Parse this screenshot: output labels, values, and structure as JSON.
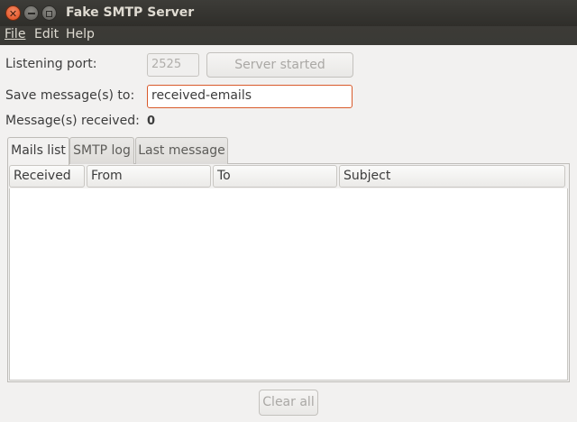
{
  "window": {
    "title": "Fake SMTP Server"
  },
  "menu": {
    "file": "File",
    "edit": "Edit",
    "help": "Help"
  },
  "form": {
    "port_label": "Listening port:",
    "port_value": "2525",
    "server_button": "Server started",
    "save_label": "Save message(s) to:",
    "save_value": "received-emails",
    "received_label": "Message(s) received:",
    "received_count": "0"
  },
  "tabs": {
    "mails": "Mails list",
    "smtp": "SMTP log",
    "last": "Last message",
    "active": "Mails list"
  },
  "table": {
    "columns": [
      "Received",
      "From",
      "To",
      "Subject"
    ],
    "rows": []
  },
  "footer": {
    "clear_button": "Clear all"
  },
  "colors": {
    "titlebar": "#3c3b37",
    "close_button": "#df4a1c",
    "focus_border": "#d95a2b"
  }
}
